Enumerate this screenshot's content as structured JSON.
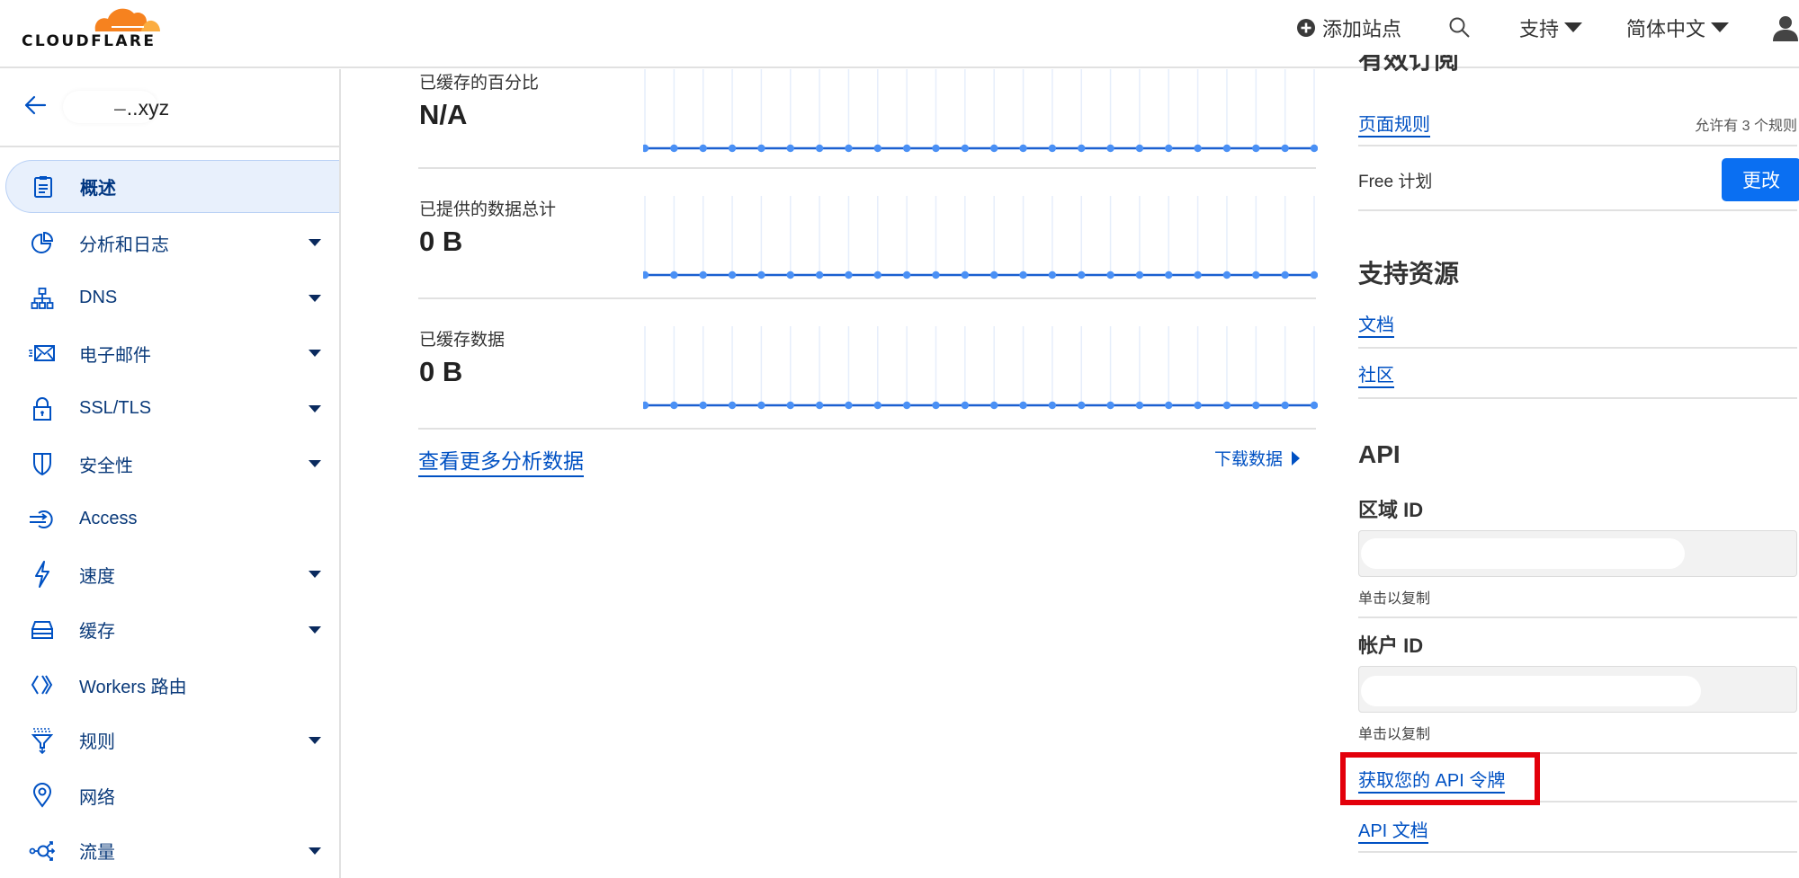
{
  "header": {
    "logo_text": "CLOUDFLARE",
    "add_site": "添加站点",
    "support": "支持",
    "language": "简体中文",
    "icons": {
      "add": "plus-circle-icon",
      "search": "search-icon",
      "user": "user-icon"
    }
  },
  "sidebar": {
    "domain_suffix": "..xyz",
    "items": [
      {
        "label": "概述",
        "icon": "clipboard-icon",
        "has_submenu": false,
        "active": true
      },
      {
        "label": "分析和日志",
        "icon": "pie-chart-icon",
        "has_submenu": true
      },
      {
        "label": "DNS",
        "icon": "network-icon",
        "has_submenu": true
      },
      {
        "label": "电子邮件",
        "icon": "email-icon",
        "has_submenu": true
      },
      {
        "label": "SSL/TLS",
        "icon": "lock-icon",
        "has_submenu": true
      },
      {
        "label": "安全性",
        "icon": "shield-icon",
        "has_submenu": true
      },
      {
        "label": "Access",
        "icon": "access-icon",
        "has_submenu": false
      },
      {
        "label": "速度",
        "icon": "lightning-icon",
        "has_submenu": true
      },
      {
        "label": "缓存",
        "icon": "storage-icon",
        "has_submenu": true
      },
      {
        "label": "Workers 路由",
        "icon": "workers-icon",
        "has_submenu": false
      },
      {
        "label": "规则",
        "icon": "filter-icon",
        "has_submenu": true
      },
      {
        "label": "网络",
        "icon": "location-pin-icon",
        "has_submenu": false
      },
      {
        "label": "流量",
        "icon": "traffic-icon",
        "has_submenu": true
      }
    ]
  },
  "main": {
    "metrics": [
      {
        "label": "已缓存的百分比",
        "value": "N/A"
      },
      {
        "label": "已提供的数据总计",
        "value": "0 B"
      },
      {
        "label": "已缓存数据",
        "value": "0 B"
      }
    ],
    "view_more": "查看更多分析数据",
    "download": "下载数据"
  },
  "right": {
    "subscription_heading": "有效订阅",
    "page_rules_link": "页面规则",
    "page_rules_note": "允许有 3 个规则",
    "plan": "Free 计划",
    "change_button": "更改",
    "support_heading": "支持资源",
    "docs_link": "文档",
    "community_link": "社区",
    "api_heading": "API",
    "zone_id_label": "区域 ID",
    "account_id_label": "帐户 ID",
    "copy_hint": "单击以复制",
    "api_token_link": "获取您的 API 令牌",
    "api_docs_link": "API 文档"
  },
  "colors": {
    "accent": "#0051c3",
    "button": "#0a6ff2",
    "highlight": "#e3000b",
    "chart_line": "#1a5fd0",
    "chart_point": "#4a90f5"
  },
  "chart_data": [
    {
      "type": "line",
      "title": "已缓存的百分比",
      "x": [
        1,
        2,
        3,
        4,
        5,
        6,
        7,
        8,
        9,
        10,
        11,
        12,
        13,
        14,
        15,
        16,
        17,
        18,
        19,
        20,
        21,
        22,
        23,
        24
      ],
      "values": [
        0,
        0,
        0,
        0,
        0,
        0,
        0,
        0,
        0,
        0,
        0,
        0,
        0,
        0,
        0,
        0,
        0,
        0,
        0,
        0,
        0,
        0,
        0,
        0
      ],
      "grid": true
    },
    {
      "type": "line",
      "title": "已提供的数据总计",
      "x": [
        1,
        2,
        3,
        4,
        5,
        6,
        7,
        8,
        9,
        10,
        11,
        12,
        13,
        14,
        15,
        16,
        17,
        18,
        19,
        20,
        21,
        22,
        23,
        24
      ],
      "values": [
        0,
        0,
        0,
        0,
        0,
        0,
        0,
        0,
        0,
        0,
        0,
        0,
        0,
        0,
        0,
        0,
        0,
        0,
        0,
        0,
        0,
        0,
        0,
        0
      ],
      "grid": true
    },
    {
      "type": "line",
      "title": "已缓存数据",
      "x": [
        1,
        2,
        3,
        4,
        5,
        6,
        7,
        8,
        9,
        10,
        11,
        12,
        13,
        14,
        15,
        16,
        17,
        18,
        19,
        20,
        21,
        22,
        23,
        24
      ],
      "values": [
        0,
        0,
        0,
        0,
        0,
        0,
        0,
        0,
        0,
        0,
        0,
        0,
        0,
        0,
        0,
        0,
        0,
        0,
        0,
        0,
        0,
        0,
        0,
        0
      ],
      "grid": true
    }
  ]
}
